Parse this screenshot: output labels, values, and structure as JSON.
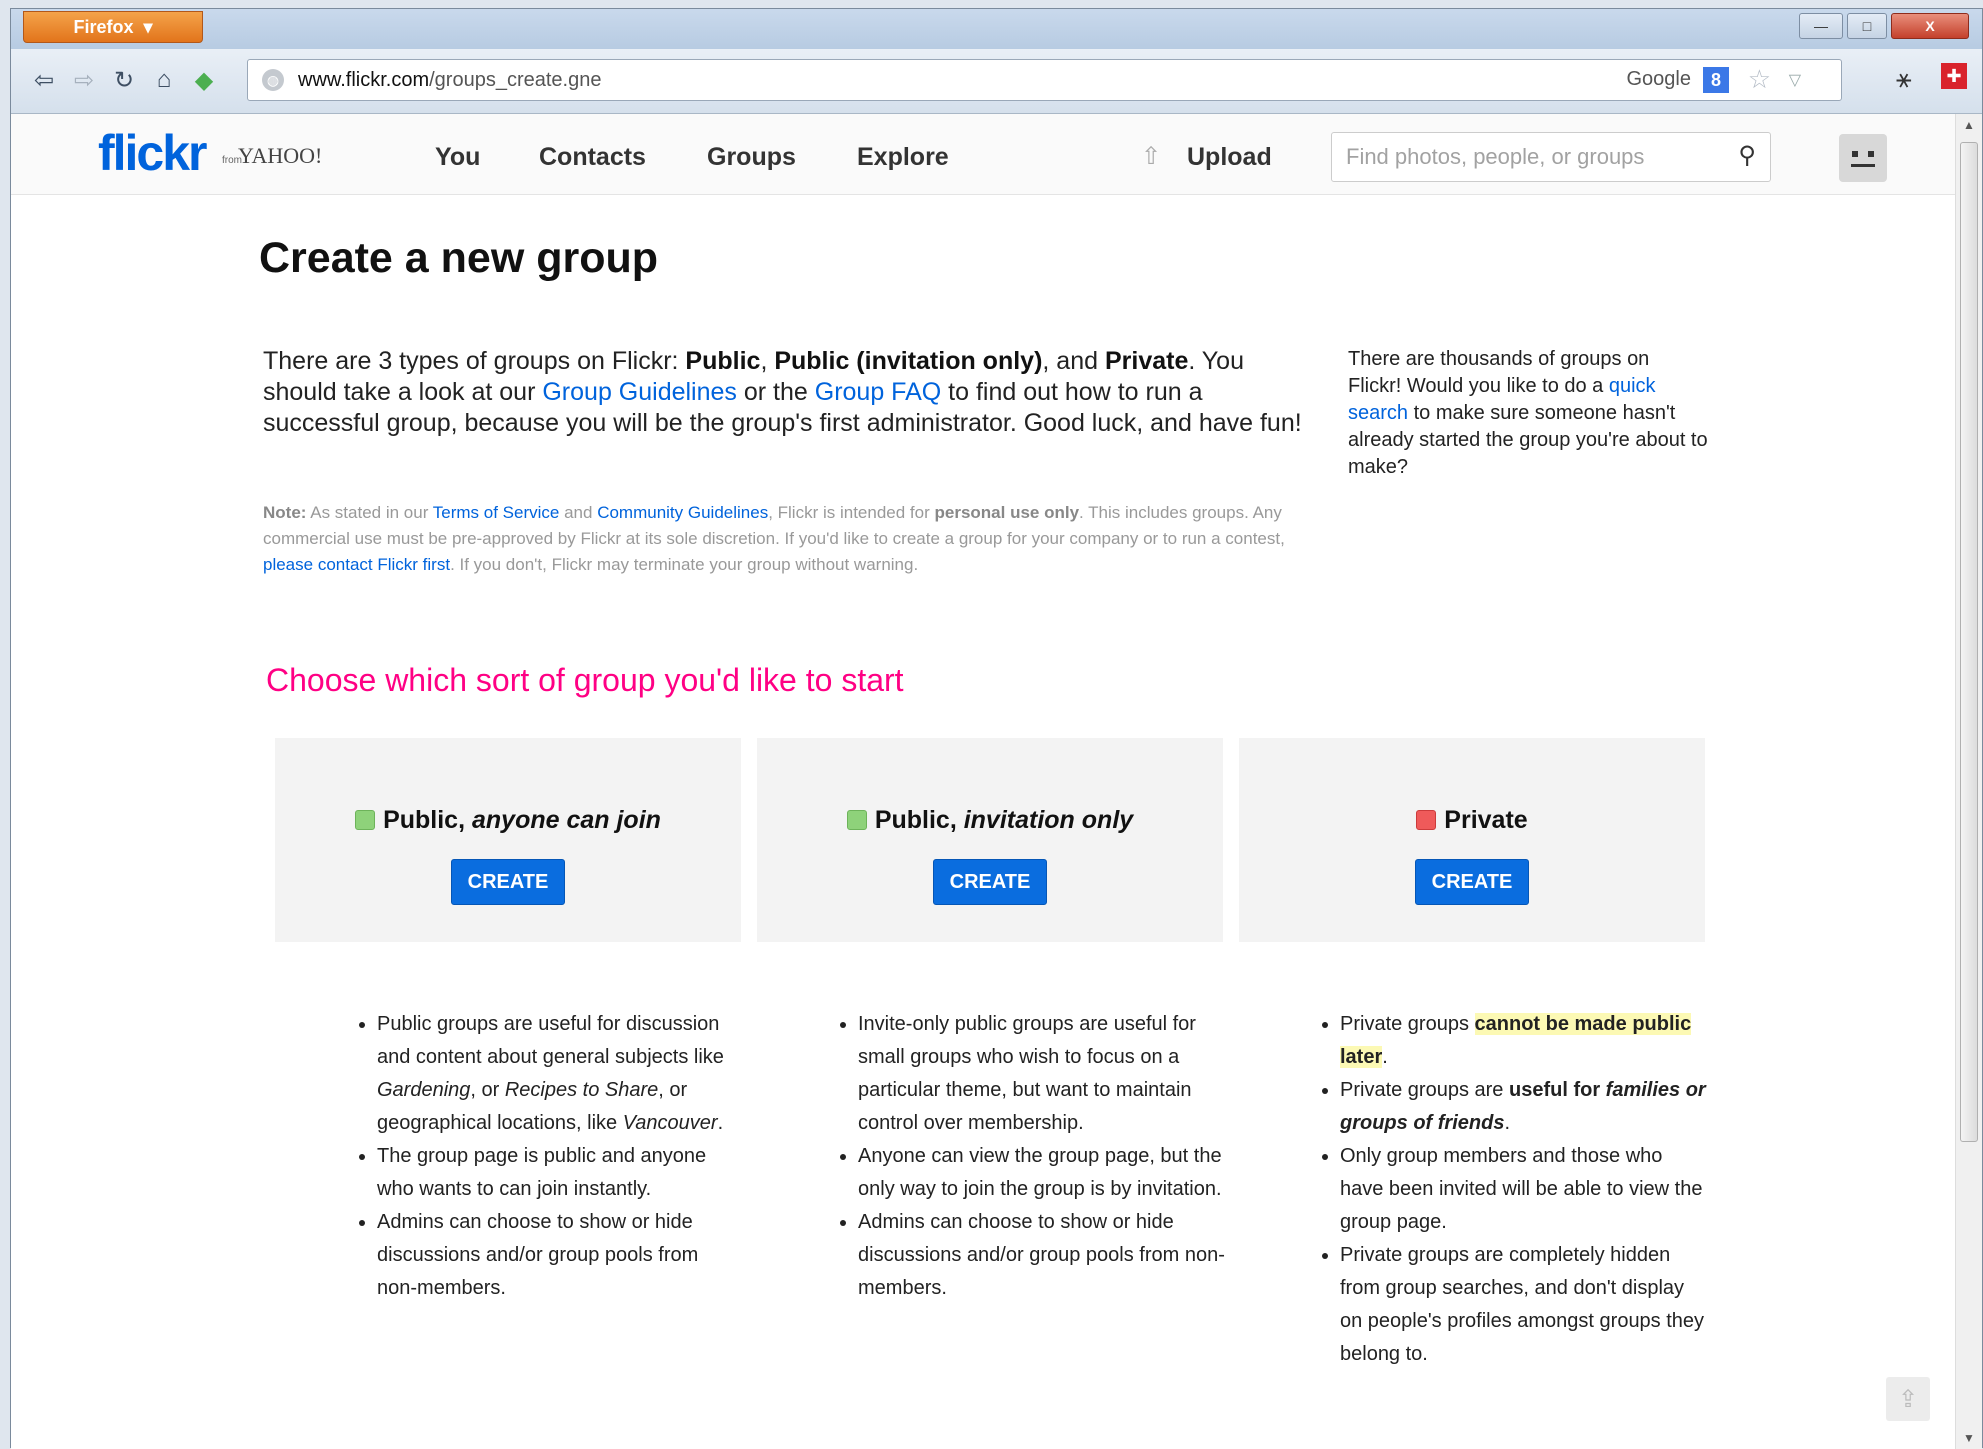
{
  "browser": {
    "menu_label": "Firefox",
    "url_domain": "www.flickr.com",
    "url_path": "/groups_create.gne",
    "search_engine_label": "Google",
    "window_controls": [
      "—",
      "□",
      "X"
    ]
  },
  "header": {
    "logo_text": "flickr",
    "logo_from": "from",
    "logo_yahoo": "YAHOO!",
    "nav": [
      "You",
      "Contacts",
      "Groups",
      "Explore"
    ],
    "upload_label": "Upload",
    "search_placeholder": "Find photos, people, or groups"
  },
  "main": {
    "title": "Create a new group",
    "intro": {
      "t1": "There are 3 types of groups on Flickr: ",
      "b1": "Public",
      "t2": ", ",
      "b2": "Public (invitation only)",
      "t3": ", and ",
      "b3": "Private",
      "t4": ". You should take a look at our ",
      "link1": "Group Guidelines",
      "t5": " or the ",
      "link2": "Group FAQ",
      "t6": " to find out how to run a successful group, because you will be the group's first administrator. Good luck, and have fun!"
    },
    "note": {
      "label": "Note:",
      "t1": " As stated in our ",
      "link1": "Terms of Service",
      "t2": " and ",
      "link2": "Community Guidelines",
      "t3": ", Flickr is intended for ",
      "b1": "personal use only",
      "t4": ". This includes groups. Any commercial use must be pre-approved by Flickr at its sole discretion. If you'd like to create a group for your company or to run a contest, ",
      "link3": "please contact Flickr first",
      "t5": ". If you don't, Flickr may terminate your group without warning."
    },
    "side": {
      "t1": "There are thousands of groups on Flickr! Would you like to do a ",
      "link": "quick search",
      "t2": " to make sure someone hasn't already started the group you're about to make?"
    },
    "choose_heading": "Choose which sort of group you'd like to start"
  },
  "cards": [
    {
      "title_a": "Public, ",
      "title_b": "anyone can join",
      "color": "#8ed27a",
      "button": "CREATE"
    },
    {
      "title_a": "Public, ",
      "title_b": "invitation only",
      "color": "#8ed27a",
      "button": "CREATE"
    },
    {
      "title_a": "Private",
      "title_b": "",
      "color": "#ef5a5a",
      "button": "CREATE"
    }
  ],
  "bullets": {
    "public": {
      "b1": {
        "t1": "Public groups are useful for discussion and content about general subjects like ",
        "i1": "Gardening",
        "t2": ", or ",
        "i2": "Recipes to Share",
        "t3": ", or geographical locations, like ",
        "i3": "Vancouver",
        "t4": "."
      },
      "b2": "The group page is public and anyone who wants to can join instantly.",
      "b3": "Admins can choose to show or hide discussions and/or group pools from non-members."
    },
    "invite": {
      "b1": "Invite-only public groups are useful for small groups who wish to focus on a particular theme, but want to maintain control over membership.",
      "b2": "Anyone can view the group page, but the only way to join the group is by invitation.",
      "b3": "Admins can choose to show or hide discussions and/or group pools from non-members."
    },
    "private": {
      "b1": {
        "t1": "Private groups ",
        "hl": "cannot be made public later",
        "t2": "."
      },
      "b2": {
        "t1": "Private groups are ",
        "b1": "useful for ",
        "bi": "families or groups of friends",
        "t2": "."
      },
      "b3": "Only group members and those who have been invited will be able to view the group page.",
      "b4": "Private groups are completely hidden from group searches, and don't display on people's profiles amongst groups they belong to."
    }
  }
}
